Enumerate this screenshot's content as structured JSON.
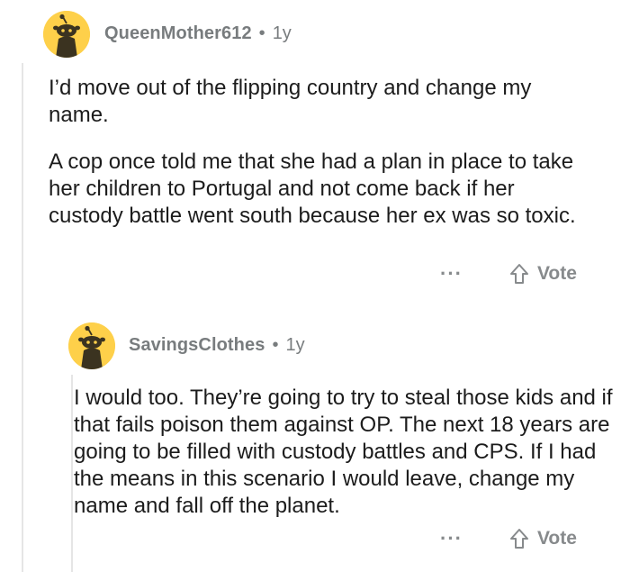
{
  "colors": {
    "avatar_bg": "#fed04a",
    "meta_text": "#787c7e",
    "body_text": "#1c1c1c",
    "action_text": "#878a8c",
    "thread_line": "#e5e5e5"
  },
  "comments": [
    {
      "author": "QueenMother612",
      "separator": "•",
      "age": "1y",
      "paragraphs": [
        "I’d move out of the flipping country and change my name.",
        "A cop once told me that she had a plan in place to take her children to Portugal and not come back if her custody battle went south because her ex was so toxic."
      ],
      "more_label": "···",
      "vote_label": "Vote",
      "avatar_icon": "snoo-avatar-icon",
      "vote_icon": "upvote-arrow-icon"
    },
    {
      "author": "SavingsClothes",
      "separator": "•",
      "age": "1y",
      "paragraphs": [
        "I would too. They’re going to try to steal those kids and if that fails poison them against OP. The next 18 years are going to be filled with custody battles and CPS. If I had the means in this scenario I would leave, change my name and fall off the planet."
      ],
      "more_label": "···",
      "vote_label": "Vote",
      "avatar_icon": "snoo-avatar-icon",
      "vote_icon": "upvote-arrow-icon"
    }
  ]
}
